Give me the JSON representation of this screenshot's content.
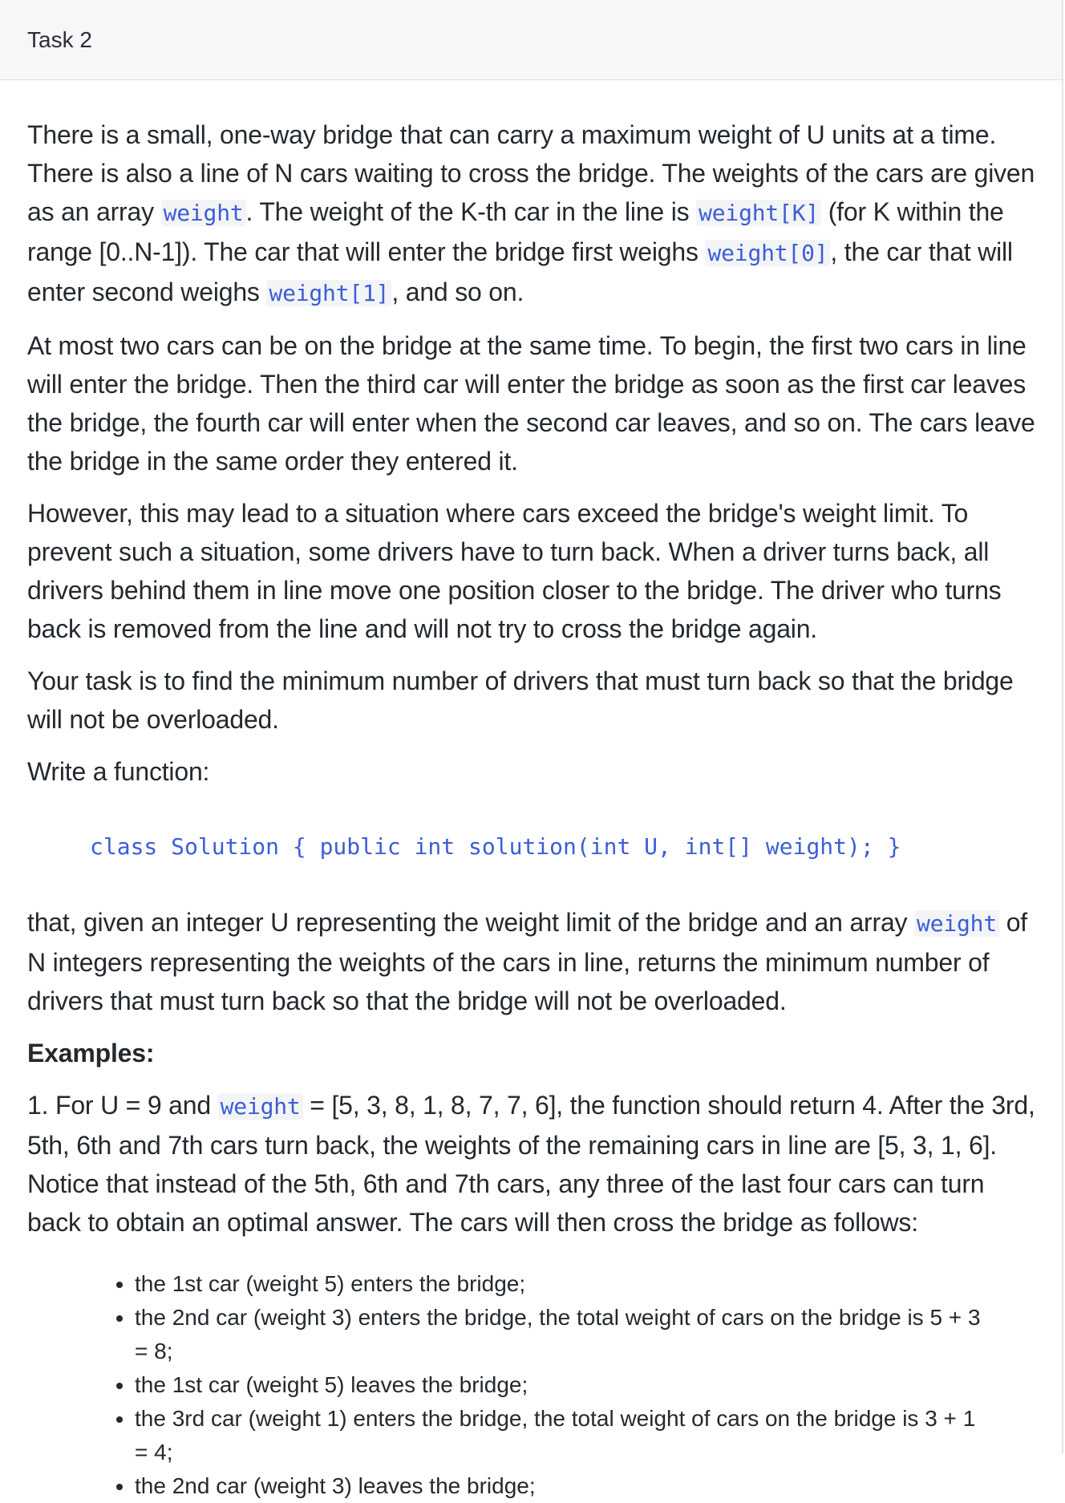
{
  "header": {
    "title": "Task 2"
  },
  "p1": {
    "t1": "There is a small, one-way bridge that can carry a maximum weight of U units at a time. There is also a line of N cars waiting to cross the bridge. The weights of the cars are given as an array ",
    "c1": "weight",
    "t2": ". The weight of the K-th car in the line is ",
    "c2": "weight[K]",
    "t3": " (for K within the range [0..N-1]). The car that will enter the bridge first weighs ",
    "c3": "weight[0]",
    "t4": ", the car that will enter second weighs ",
    "c4": "weight[1]",
    "t5": ", and so on."
  },
  "p2": "At most two cars can be on the bridge at the same time. To begin, the first two cars in line will enter the bridge. Then the third car will enter the bridge as soon as the first car leaves the bridge, the fourth car will enter when the second car leaves, and so on. The cars leave the bridge in the same order they entered it.",
  "p3": "However, this may lead to a situation where cars exceed the bridge's weight limit. To prevent such a situation, some drivers have to turn back. When a driver turns back, all drivers behind them in line move one position closer to the bridge. The driver who turns back is removed from the line and will not try to cross the bridge again.",
  "p4": "Your task is to find the minimum number of drivers that must turn back so that the bridge will not be overloaded.",
  "p5": "Write a function:",
  "code_block": "class Solution { public int solution(int U, int[] weight); }",
  "p6": {
    "t1": "that, given an integer U representing the weight limit of the bridge and an array ",
    "c1": "weight",
    "t2": " of N integers representing the weights of the cars in line, returns the minimum number of drivers that must turn back so that the bridge will not be overloaded."
  },
  "examples_heading": "Examples:",
  "example1": {
    "t1": "1. For U = 9 and ",
    "c1": "weight",
    "t2": " = [5, 3, 8, 1, 8, 7, 7, 6], the function should return 4. After the 3rd, 5th, 6th and 7th cars turn back, the weights of the remaining cars in line are [5, 3, 1, 6]. Notice that instead of the 5th, 6th and 7th cars, any three of the last four cars can turn back to obtain an optimal answer. The cars will then cross the bridge as follows:"
  },
  "steps": [
    "the 1st car (weight 5) enters the bridge;",
    "the 2nd car (weight 3) enters the bridge, the total weight of cars on the bridge is 5 + 3 = 8;",
    "the 1st car (weight 5) leaves the bridge;",
    "the 3rd car (weight 1) enters the bridge, the total weight of cars on the bridge is 3 + 1 = 4;",
    "the 2nd car (weight 3) leaves the bridge;"
  ]
}
